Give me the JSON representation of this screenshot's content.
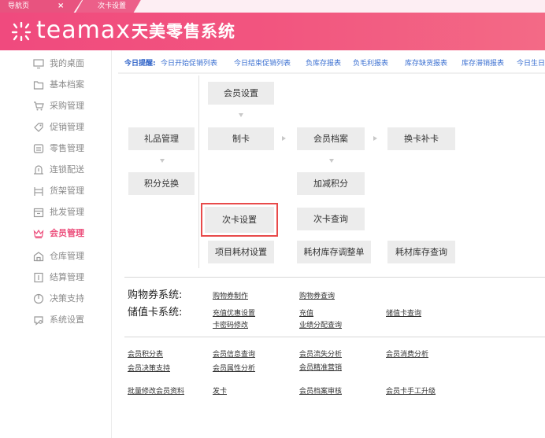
{
  "tabs": {
    "home_label": "导航页",
    "close_glyph": "×",
    "active_label": "次卡设置"
  },
  "header": {
    "logo_text": "teamax",
    "system_title": "天美零售系统"
  },
  "sidebar": {
    "items": [
      {
        "label": "我的桌面",
        "icon": "monitor-icon"
      },
      {
        "label": "基本档案",
        "icon": "folder-icon"
      },
      {
        "label": "采购管理",
        "icon": "cart-icon"
      },
      {
        "label": "促销管理",
        "icon": "tag-icon"
      },
      {
        "label": "零售管理",
        "icon": "register-icon"
      },
      {
        "label": "连锁配送",
        "icon": "delivery-icon"
      },
      {
        "label": "货架管理",
        "icon": "shelf-icon"
      },
      {
        "label": "批发管理",
        "icon": "box-icon"
      },
      {
        "label": "会员管理",
        "icon": "crown-icon"
      },
      {
        "label": "仓库管理",
        "icon": "warehouse-icon"
      },
      {
        "label": "结算管理",
        "icon": "ledger-icon"
      },
      {
        "label": "决策支持",
        "icon": "chart-icon"
      },
      {
        "label": "系统设置",
        "icon": "settings-icon"
      }
    ],
    "active_index": 8,
    "accent_color": "#ec4f7c"
  },
  "notice": {
    "lead": "今日提醒:",
    "links": [
      "今日开始促销列表",
      "今日结束促销列表",
      "负库存报表",
      "负毛利报表",
      "库存缺货报表",
      "库存滞销报表",
      "今日生日"
    ]
  },
  "flow": {
    "member_settings": "会员设置",
    "gift_management": "礼品管理",
    "make_card": "制卡",
    "member_archive": "会员档案",
    "card_replacement": "换卡补卡",
    "points_exchange": "积分兑换",
    "points_adjust": "加减积分",
    "times_card_settings": "次卡设置",
    "times_card_query": "次卡查询",
    "project_material_settings": "项目耗材设置",
    "material_stock_adjust": "耗材库存调整单",
    "material_stock_query": "耗材库存查询"
  },
  "coupon": {
    "label": "购物券系统:",
    "links": [
      "购物券制作",
      "购物券查询"
    ]
  },
  "stored_value": {
    "label": "储值卡系统:",
    "links": [
      "充值优惠设置",
      "充值",
      "储值卡查询",
      "卡密码修改",
      "业绩分配查询"
    ]
  },
  "reports": {
    "links": [
      "会员积分表",
      "会员信息查询",
      "会员流失分析",
      "会员消费分析",
      "会员决策支持",
      "会员属性分析",
      "会员精准营销",
      "批量修改会员资料",
      "发卡",
      "会员档案审核",
      "会员卡手工升级"
    ]
  }
}
